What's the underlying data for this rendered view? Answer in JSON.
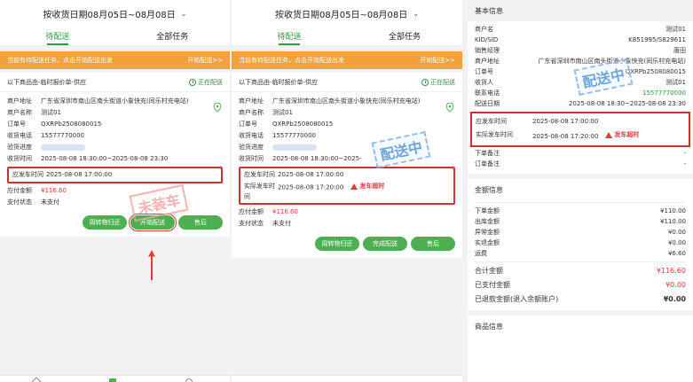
{
  "top": {
    "title": "按收货日期08月05日~08月08日",
    "chev": "⌄"
  },
  "tabs": {
    "t1": "待配送",
    "t2": "全部任务"
  },
  "banner": {
    "msg": "当前有待配送任务，点击开始配送出发",
    "action": "开始配送>>"
  },
  "p1": {
    "source": "以下商品由-临时报价单-供应",
    "status": "正在配送",
    "stamp": "未装车",
    "fields": [
      {
        "k": "商户地址",
        "v": "广东省深圳市南山区南头街道小象快充(同乐村充电站)"
      },
      {
        "k": "商户名称",
        "v": "测试01"
      },
      {
        "k": "订单号",
        "v": "QXRPb2508080015"
      },
      {
        "k": "收货电话",
        "v": "15577770000"
      },
      {
        "k": "验货进度",
        "v": ""
      },
      {
        "k": "收货时间",
        "v": "2025-08-08 18:30:00~2025-08-08 23:30"
      }
    ],
    "hl": {
      "k": "应发车时间",
      "v": "2025-08-08  17:00:00"
    },
    "after": [
      {
        "k": "应付金额",
        "v": "¥116.60"
      },
      {
        "k": "支付状态",
        "v": "未支付"
      }
    ],
    "buttons": [
      "周转物归还",
      "开始配送",
      "售后"
    ]
  },
  "p2": {
    "source": "以下商品由-临时报价单-供应",
    "status": "正在配送",
    "stamp": "配送中",
    "fields": [
      {
        "k": "商户地址",
        "v": "广东省深圳市南山区南头街道小象快充(同乐村充电站)"
      },
      {
        "k": "商户名称",
        "v": "测试01"
      },
      {
        "k": "订单号",
        "v": "QXRPb2508080015"
      },
      {
        "k": "收货电话",
        "v": "15577770000"
      },
      {
        "k": "验货进度",
        "v": ""
      },
      {
        "k": "收货时间",
        "v": "2025-08-08 18:30:00~2025-"
      }
    ],
    "hl1": {
      "k": "应发车时间",
      "v": "2025-08-08  17:00:00"
    },
    "hl2": {
      "k": "实际发车时间",
      "v": "2025-08-08  17:20:00",
      "late": "发车超时"
    },
    "after": [
      {
        "k": "应付金额",
        "v": "¥116.60"
      },
      {
        "k": "支付状态",
        "v": "未支付"
      }
    ],
    "buttons": [
      "周转物归还",
      "完成配送",
      "售后"
    ]
  },
  "p3": {
    "basic_title": "基本信息",
    "stamp": "配送中",
    "basic": [
      {
        "k": "商户名",
        "v": "测试01"
      },
      {
        "k": "KID/SID",
        "v": "K851995/S829611"
      },
      {
        "k": "销售经理",
        "v": "唐田"
      },
      {
        "k": "商户地址",
        "v": "广东省深圳市南山区南头街道小象快充(同乐村充电站)"
      },
      {
        "k": "订单号",
        "v": "QXRPb2508080015"
      },
      {
        "k": "收货人",
        "v": "测试01"
      },
      {
        "k": "联系电话",
        "v": "15577770000"
      },
      {
        "k": "配送日期",
        "v": "2025-08-08 18:30~2025-08-08 23:30"
      }
    ],
    "hl1": {
      "k": "应发车时间",
      "v": "2025-08-08  17:00:00"
    },
    "hl2": {
      "k": "实际发车时间",
      "v": "2025-08-08  17:20:00",
      "late": "发车超时"
    },
    "basic_after": [
      {
        "k": "下单备注",
        "v": "-"
      },
      {
        "k": "订单备注",
        "v": "-"
      }
    ],
    "amount_title": "金额信息",
    "amounts": [
      {
        "k": "下单金额",
        "v": "¥110.00"
      },
      {
        "k": "出库金额",
        "v": "¥110.00"
      },
      {
        "k": "异常金额",
        "v": "¥0.00"
      },
      {
        "k": "实退金额",
        "v": "¥0.00"
      },
      {
        "k": "运费",
        "v": "¥6.60"
      }
    ],
    "totals": [
      {
        "k": "合计金额",
        "v": "¥116.60"
      },
      {
        "k": "已支付金额",
        "v": "¥0.00"
      },
      {
        "k": "已退款金额(退入余额账户)",
        "v": "¥0.00"
      }
    ],
    "goods_title": "商品信息"
  }
}
